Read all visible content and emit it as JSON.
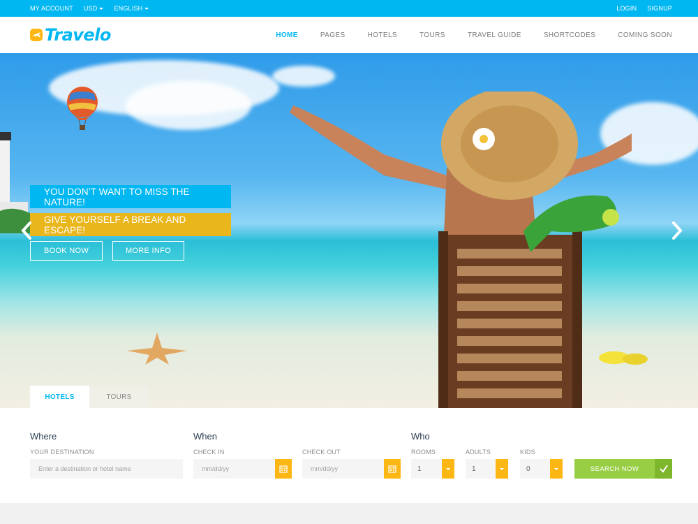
{
  "topbar": {
    "my_account": "MY ACCOUNT",
    "currency": "USD",
    "language": "ENGLISH",
    "login": "LOGIN",
    "signup": "SIGNUP"
  },
  "brand": {
    "name": "Travelo"
  },
  "nav": {
    "items": [
      "HOME",
      "PAGES",
      "HOTELS",
      "TOURS",
      "TRAVEL GUIDE",
      "SHORTCODES",
      "COMING SOON"
    ],
    "active": "HOME"
  },
  "hero": {
    "tagline_1": "YOU DON’T WANT TO MISS THE NATURE!",
    "tagline_2": "GIVE YOURSELF A BREAK AND ESCAPE!",
    "book_now": "BOOK NOW",
    "more_info": "MORE INFO"
  },
  "tabs": [
    "HOTELS",
    "TOURS"
  ],
  "search": {
    "where": {
      "title": "Where",
      "label": "YOUR DESTINATION",
      "placeholder": "Enter a destination or hotel name"
    },
    "when": {
      "title": "When",
      "checkin_label": "CHECK IN",
      "checkout_label": "CHECK OUT",
      "date_placeholder": "mm/dd/yy"
    },
    "who": {
      "title": "Who",
      "rooms_label": "ROOMS",
      "rooms_value": "1",
      "adults_label": "ADULTS",
      "adults_value": "1",
      "kids_label": "KIDS",
      "kids_value": "0"
    },
    "button": "SEARCH NOW"
  },
  "colors": {
    "primary": "#01b7f2",
    "accent": "#fdb714",
    "tag_yellow": "#e9b61c",
    "search_green": "#98ce44"
  }
}
